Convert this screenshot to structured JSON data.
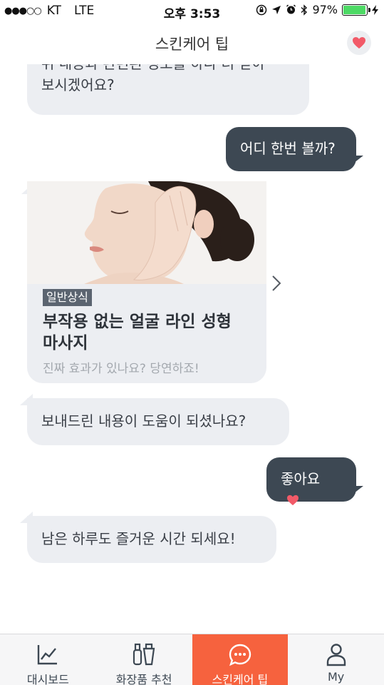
{
  "status_bar": {
    "signal": "●●●○○",
    "carrier": "KT",
    "network": "LTE",
    "time": "오후 3:53",
    "battery_percent": "97%",
    "battery_level": 0.97
  },
  "header": {
    "title": "스킨케어 팁",
    "favorite_icon": "heart-icon"
  },
  "chat": {
    "messages": [
      {
        "sender": "bot",
        "text_line1": "위 내용과 관련된 정보를 하나 더 받아",
        "text_line2": "보시겠어요?"
      },
      {
        "sender": "user",
        "text": "어디 한번 볼까?"
      },
      {
        "sender": "bot",
        "text": "보내드린 내용이 도움이 되셨나요?"
      },
      {
        "sender": "user",
        "text": "좋아요",
        "icon": "heart-icon"
      },
      {
        "sender": "bot",
        "text": "남은 하루도 즐거운 시간 되세요!"
      }
    ],
    "card": {
      "tag": "일반상식",
      "title_line1": "부작용 없는 얼굴 라인 성형",
      "title_line2": "마사지",
      "description": "진짜 효과가 있나요? 당연하죠!",
      "next_icon": "chevron-right-icon"
    }
  },
  "tabbar": {
    "tabs": [
      {
        "label": "대시보드",
        "icon": "chart-line-icon",
        "active": false
      },
      {
        "label": "화장품 추천",
        "icon": "cosmetics-icon",
        "active": false
      },
      {
        "label": "스킨케어 팁",
        "icon": "chat-bubble-icon",
        "active": true
      },
      {
        "label": "My",
        "icon": "person-icon",
        "active": false
      }
    ]
  },
  "colors": {
    "accent": "#f6623e",
    "user_bubble": "#3d4853",
    "bot_bubble": "#eceef2",
    "heart": "#f25a68"
  }
}
